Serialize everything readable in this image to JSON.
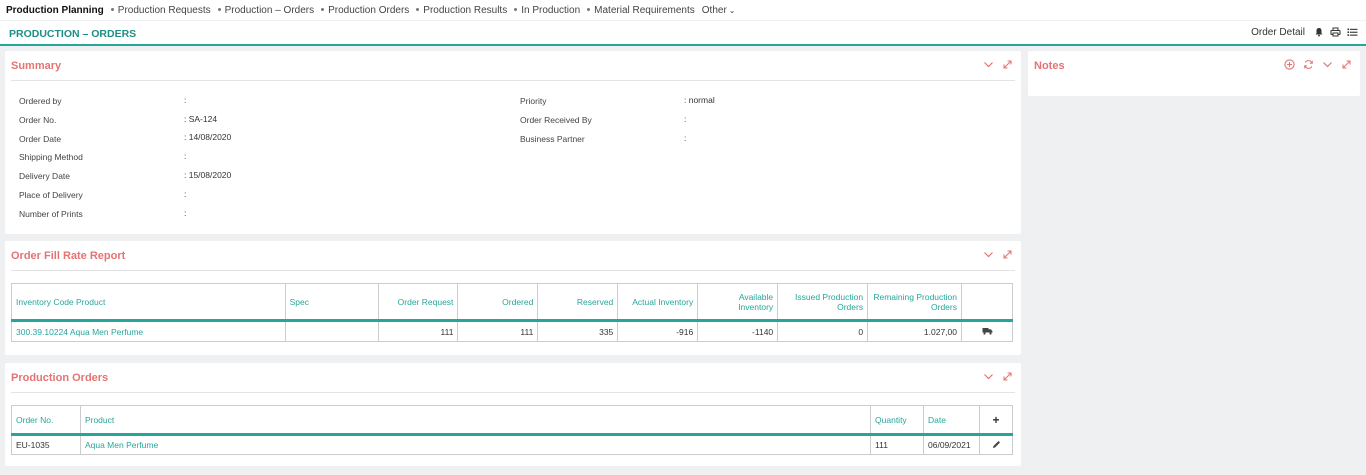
{
  "nav": {
    "items": [
      {
        "label": "Production Planning",
        "active": true
      },
      {
        "label": "Production Requests"
      },
      {
        "label": "Production – Orders"
      },
      {
        "label": "Production Orders"
      },
      {
        "label": "Production Results"
      },
      {
        "label": "In Production"
      },
      {
        "label": "Material Requirements"
      }
    ],
    "other_label": "Other"
  },
  "page": {
    "title": "PRODUCTION – ORDERS",
    "order_detail_label": "Order Detail",
    "icons": [
      "bell-icon",
      "print-icon",
      "list-icon"
    ]
  },
  "summary": {
    "title": "Summary",
    "left_fields": [
      {
        "label": "Ordered by",
        "value": ":"
      },
      {
        "label": "Order No.",
        "value": ": SA-124"
      },
      {
        "label": "Order Date",
        "value": ": 14/08/2020"
      },
      {
        "label": "Shipping Method",
        "value": ":"
      },
      {
        "label": "Delivery Date",
        "value": ": 15/08/2020"
      },
      {
        "label": "Place of Delivery",
        "value": ":"
      },
      {
        "label": "Number of Prints",
        "value": ":"
      }
    ],
    "right_fields": [
      {
        "label": "Priority",
        "value": ": normal"
      },
      {
        "label": "Order Received By",
        "value": ":"
      },
      {
        "label": "Business Partner",
        "value": ":"
      }
    ]
  },
  "notes": {
    "title": "Notes"
  },
  "fill_rate": {
    "title": "Order Fill Rate Report",
    "headers": {
      "product": "Inventory Code Product",
      "spec": "Spec",
      "order_request": "Order Request",
      "ordered": "Ordered",
      "reserved": "Reserved",
      "actual_inventory": "Actual Inventory",
      "available_inventory": "Available Inventory",
      "issued": "Issued Production Orders",
      "remaining": "Remaining Production Orders"
    },
    "rows": [
      {
        "product": "300.39.10224 Aqua Men Perfume",
        "spec": "",
        "order_request": "111",
        "ordered": "111",
        "reserved": "335",
        "actual_inventory": "-916",
        "available_inventory": "-1140",
        "issued": "0",
        "remaining": "1.027,00"
      }
    ]
  },
  "production_orders": {
    "title": "Production Orders",
    "headers": {
      "order_no": "Order No.",
      "product": "Product",
      "quantity": "Quantity",
      "date": "Date",
      "add": "+"
    },
    "rows": [
      {
        "order_no": "EU-1035",
        "product": "Aqua Men Perfume",
        "quantity": "111",
        "date": "06/09/2021"
      }
    ]
  }
}
